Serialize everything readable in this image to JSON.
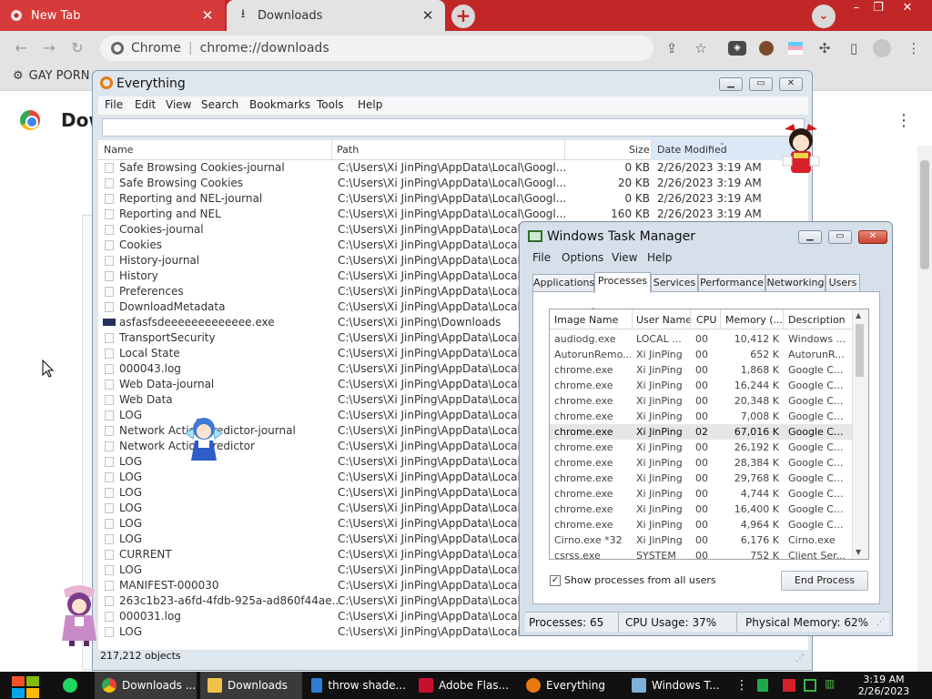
{
  "chrome": {
    "tabs": [
      {
        "title": "New Tab",
        "active": false
      },
      {
        "title": "Downloads",
        "active": true
      }
    ],
    "omnibox": {
      "site_label": "Chrome",
      "url": "chrome://downloads"
    },
    "bookmark_item": "GAY PORN",
    "page_title": "Downloads",
    "new_tab_glyph": "+",
    "tab_search_glyph": "⌄",
    "window_controls": [
      "–",
      "❐",
      "✕"
    ]
  },
  "everything": {
    "title": "Everything",
    "menu": [
      "File",
      "Edit",
      "View",
      "Search",
      "Bookmarks",
      "Tools",
      "Help"
    ],
    "search_value": "",
    "columns": {
      "name": "Name",
      "path": "Path",
      "size": "Size",
      "date": "Date Modified"
    },
    "rows": [
      {
        "name": "Safe Browsing Cookies-journal",
        "path": "C:\\Users\\Xi JinPing\\AppData\\Local\\Googl...",
        "size": "0 KB",
        "date": "2/26/2023 3:19 AM",
        "exe": false
      },
      {
        "name": "Safe Browsing Cookies",
        "path": "C:\\Users\\Xi JinPing\\AppData\\Local\\Googl...",
        "size": "20 KB",
        "date": "2/26/2023 3:19 AM",
        "exe": false
      },
      {
        "name": "Reporting and NEL-journal",
        "path": "C:\\Users\\Xi JinPing\\AppData\\Local\\Googl...",
        "size": "0 KB",
        "date": "2/26/2023 3:19 AM",
        "exe": false
      },
      {
        "name": "Reporting and NEL",
        "path": "C:\\Users\\Xi JinPing\\AppData\\Local\\Googl...",
        "size": "160 KB",
        "date": "2/26/2023 3:19 AM",
        "exe": false
      },
      {
        "name": "Cookies-journal",
        "path": "C:\\Users\\Xi JinPing\\AppData\\Local",
        "size": "",
        "date": "",
        "exe": false
      },
      {
        "name": "Cookies",
        "path": "C:\\Users\\Xi JinPing\\AppData\\Local",
        "size": "",
        "date": "",
        "exe": false
      },
      {
        "name": "History-journal",
        "path": "C:\\Users\\Xi JinPing\\AppData\\Local",
        "size": "",
        "date": "",
        "exe": false
      },
      {
        "name": "History",
        "path": "C:\\Users\\Xi JinPing\\AppData\\Local",
        "size": "",
        "date": "",
        "exe": false
      },
      {
        "name": "Preferences",
        "path": "C:\\Users\\Xi JinPing\\AppData\\Local",
        "size": "",
        "date": "",
        "exe": false
      },
      {
        "name": "DownloadMetadata",
        "path": "C:\\Users\\Xi JinPing\\AppData\\Local",
        "size": "",
        "date": "",
        "exe": false
      },
      {
        "name": "asfasfsdeeeeeeeeeeeee.exe",
        "path": "C:\\Users\\Xi JinPing\\Downloads",
        "size": "",
        "date": "",
        "exe": true
      },
      {
        "name": "TransportSecurity",
        "path": "C:\\Users\\Xi JinPing\\AppData\\Local",
        "size": "",
        "date": "",
        "exe": false
      },
      {
        "name": "Local State",
        "path": "C:\\Users\\Xi JinPing\\AppData\\Local",
        "size": "",
        "date": "",
        "exe": false
      },
      {
        "name": "000043.log",
        "path": "C:\\Users\\Xi JinPing\\AppData\\Local",
        "size": "",
        "date": "",
        "exe": false
      },
      {
        "name": "Web Data-journal",
        "path": "C:\\Users\\Xi JinPing\\AppData\\Local",
        "size": "",
        "date": "",
        "exe": false
      },
      {
        "name": "Web Data",
        "path": "C:\\Users\\Xi JinPing\\AppData\\Local",
        "size": "",
        "date": "",
        "exe": false
      },
      {
        "name": "LOG",
        "path": "C:\\Users\\Xi JinPing\\AppData\\Local",
        "size": "",
        "date": "",
        "exe": false
      },
      {
        "name": "Network Action Predictor-journal",
        "path": "C:\\Users\\Xi JinPing\\AppData\\Local",
        "size": "",
        "date": "",
        "exe": false
      },
      {
        "name": "Network Action Predictor",
        "path": "C:\\Users\\Xi JinPing\\AppData\\Local",
        "size": "",
        "date": "",
        "exe": false
      },
      {
        "name": "LOG",
        "path": "C:\\Users\\Xi JinPing\\AppData\\Local",
        "size": "",
        "date": "",
        "exe": false
      },
      {
        "name": "LOG",
        "path": "C:\\Users\\Xi JinPing\\AppData\\Local",
        "size": "",
        "date": "",
        "exe": false
      },
      {
        "name": "LOG",
        "path": "C:\\Users\\Xi JinPing\\AppData\\Local",
        "size": "",
        "date": "",
        "exe": false
      },
      {
        "name": "LOG",
        "path": "C:\\Users\\Xi JinPing\\AppData\\Local",
        "size": "",
        "date": "",
        "exe": false
      },
      {
        "name": "LOG",
        "path": "C:\\Users\\Xi JinPing\\AppData\\Local",
        "size": "",
        "date": "",
        "exe": false
      },
      {
        "name": "LOG",
        "path": "C:\\Users\\Xi JinPing\\AppData\\Local",
        "size": "",
        "date": "",
        "exe": false
      },
      {
        "name": "CURRENT",
        "path": "C:\\Users\\Xi JinPing\\AppData\\Local",
        "size": "",
        "date": "",
        "exe": false
      },
      {
        "name": "LOG",
        "path": "C:\\Users\\Xi JinPing\\AppData\\Local",
        "size": "",
        "date": "",
        "exe": false
      },
      {
        "name": "MANIFEST-000030",
        "path": "C:\\Users\\Xi JinPing\\AppData\\Local",
        "size": "",
        "date": "",
        "exe": false
      },
      {
        "name": "263c1b23-a6fd-4fdb-925a-ad860f44ae...",
        "path": "C:\\Users\\Xi JinPing\\AppData\\Local",
        "size": "",
        "date": "",
        "exe": false
      },
      {
        "name": "000031.log",
        "path": "C:\\Users\\Xi JinPing\\AppData\\Local",
        "size": "",
        "date": "",
        "exe": false
      },
      {
        "name": "LOG",
        "path": "C:\\Users\\Xi JinPing\\AppData\\Local",
        "size": "",
        "date": "",
        "exe": false
      }
    ],
    "status": "217,212 objects"
  },
  "taskmgr": {
    "title": "Windows Task Manager",
    "menu": [
      "File",
      "Options",
      "View",
      "Help"
    ],
    "tabs": [
      "Applications",
      "Processes",
      "Services",
      "Performance",
      "Networking",
      "Users"
    ],
    "active_tab": "Processes",
    "columns": [
      "Image Name",
      "User Name",
      "CPU",
      "Memory (...",
      "Description"
    ],
    "rows": [
      [
        "audiodg.exe",
        "LOCAL ...",
        "00",
        "10,412 K",
        "Windows ..."
      ],
      [
        "AutorunRemo...",
        "Xi JinPing",
        "00",
        "652 K",
        "AutorunR..."
      ],
      [
        "chrome.exe",
        "Xi JinPing",
        "00",
        "1,868 K",
        "Google C..."
      ],
      [
        "chrome.exe",
        "Xi JinPing",
        "00",
        "16,244 K",
        "Google C..."
      ],
      [
        "chrome.exe",
        "Xi JinPing",
        "00",
        "20,348 K",
        "Google C..."
      ],
      [
        "chrome.exe",
        "Xi JinPing",
        "00",
        "7,008 K",
        "Google C..."
      ],
      [
        "chrome.exe",
        "Xi JinPing",
        "02",
        "67,016 K",
        "Google C..."
      ],
      [
        "chrome.exe",
        "Xi JinPing",
        "00",
        "26,192 K",
        "Google C..."
      ],
      [
        "chrome.exe",
        "Xi JinPing",
        "00",
        "28,384 K",
        "Google C..."
      ],
      [
        "chrome.exe",
        "Xi JinPing",
        "00",
        "29,768 K",
        "Google C..."
      ],
      [
        "chrome.exe",
        "Xi JinPing",
        "00",
        "4,744 K",
        "Google C..."
      ],
      [
        "chrome.exe",
        "Xi JinPing",
        "00",
        "16,400 K",
        "Google C..."
      ],
      [
        "chrome.exe",
        "Xi JinPing",
        "00",
        "4,964 K",
        "Google C..."
      ],
      [
        "Cirno.exe *32",
        "Xi JinPing",
        "00",
        "6,176 K",
        "Cirno.exe"
      ],
      [
        "csrss.exe",
        "SYSTEM",
        "00",
        "752 K",
        "Client Ser..."
      ]
    ],
    "selected_row": 6,
    "show_all_label": "Show processes from all users",
    "show_all_checked": true,
    "end_process_label": "End Process",
    "status": {
      "processes": "Processes: 65",
      "cpu": "CPU Usage: 37%",
      "memory": "Physical Memory: 62%"
    }
  },
  "taskbar": {
    "items": [
      {
        "label": "Downloads ...",
        "icon": "chrome-icon",
        "highlight": true
      },
      {
        "label": "Downloads",
        "icon": "folder-icon",
        "highlight": true
      },
      {
        "label": "throw shade...",
        "icon": "network-icon",
        "highlight": false
      },
      {
        "label": "Adobe Flas...",
        "icon": "flash-icon",
        "highlight": false
      },
      {
        "label": "Everything",
        "icon": "everything-icon",
        "highlight": false
      },
      {
        "label": "Windows T...",
        "icon": "taskmgr-icon",
        "highlight": false
      }
    ],
    "clock_time": "3:19 AM",
    "clock_date": "2/26/2023"
  },
  "colors": {
    "chrome_frame": "#c12727",
    "taskbar": "#111111",
    "everything_accent": "#e8790c"
  }
}
